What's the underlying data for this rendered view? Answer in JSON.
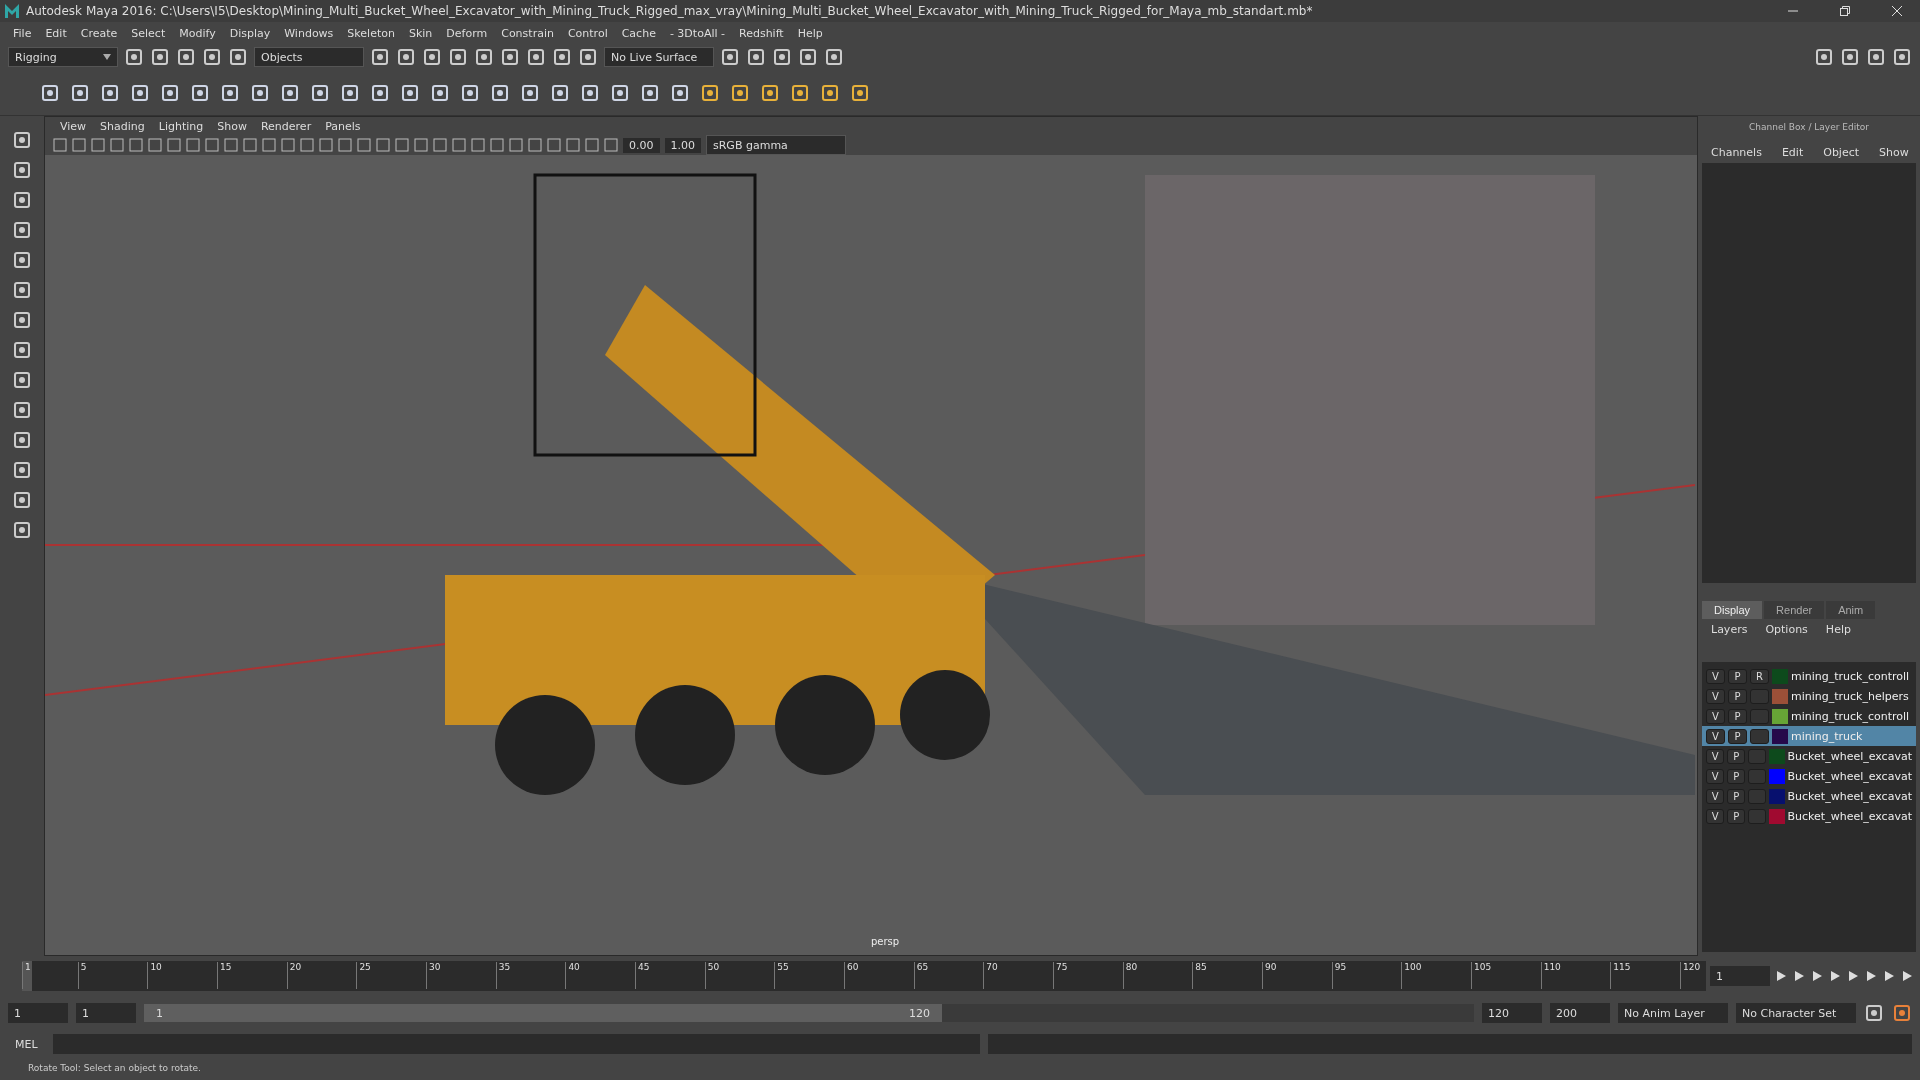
{
  "window": {
    "title": "Autodesk Maya 2016: C:\\Users\\I5\\Desktop\\Mining_Multi_Bucket_Wheel_Excavator_with_Mining_Truck_Rigged_max_vray\\Mining_Multi_Bucket_Wheel_Excavator_with_Mining_Truck_Rigged_for_Maya_mb_standart.mb*"
  },
  "menu": [
    "File",
    "Edit",
    "Create",
    "Select",
    "Modify",
    "Display",
    "Windows",
    "Skeleton",
    "Skin",
    "Deform",
    "Constrain",
    "Control",
    "Cache",
    "- 3DtoAll -",
    "Redshift",
    "Help"
  ],
  "status_line": {
    "mode": "Rigging",
    "selection_mode": "Objects",
    "live_surface": "No Live Surface"
  },
  "viewport": {
    "menu": [
      "View",
      "Shading",
      "Lighting",
      "Show",
      "Renderer",
      "Panels"
    ],
    "exposure": "0.00",
    "gamma": "1.00",
    "color_space": "sRGB gamma",
    "camera": "persp"
  },
  "channel_box": {
    "title": "Channel Box / Layer Editor",
    "menu": [
      "Channels",
      "Edit",
      "Object",
      "Show"
    ]
  },
  "layer_editor": {
    "tabs": [
      {
        "label": "Display",
        "selected": true
      },
      {
        "label": "Render",
        "selected": false
      },
      {
        "label": "Anim",
        "selected": false
      }
    ],
    "menu": [
      "Layers",
      "Options",
      "Help"
    ],
    "layers": [
      {
        "v": "V",
        "p": "P",
        "r": "R",
        "color": "#0d4a1c",
        "name": "mining_truck_controll",
        "selected": false
      },
      {
        "v": "V",
        "p": "P",
        "color": "#9c5038",
        "name": "mining_truck_helpers",
        "selected": false
      },
      {
        "v": "V",
        "p": "P",
        "color": "#67a536",
        "name": "mining_truck_controll",
        "selected": false
      },
      {
        "v": "V",
        "p": "P",
        "color": "#26094a",
        "name": "mining_truck",
        "selected": true
      },
      {
        "v": "V",
        "p": "P",
        "color": "#0d4a1c",
        "name": "Bucket_wheel_excavat",
        "selected": false
      },
      {
        "v": "V",
        "p": "P",
        "color": "#0000ff",
        "name": "Bucket_wheel_excavat",
        "selected": false
      },
      {
        "v": "V",
        "p": "P",
        "color": "#07106e",
        "name": "Bucket_wheel_excavat",
        "selected": false
      },
      {
        "v": "V",
        "p": "P",
        "color": "#a00a30",
        "name": "Bucket_wheel_excavat",
        "selected": false
      }
    ]
  },
  "timeline": {
    "ticks": [
      "1",
      "5",
      "10",
      "15",
      "20",
      "25",
      "30",
      "35",
      "40",
      "45",
      "50",
      "55",
      "60",
      "65",
      "70",
      "75",
      "80",
      "85",
      "90",
      "95",
      "100",
      "105",
      "110",
      "115",
      "120"
    ],
    "current_frame": "1",
    "level": 0
  },
  "range": {
    "start": "1",
    "playback_start": "1",
    "slider_start": "1",
    "slider_end": "120",
    "playback_end": "120",
    "end": "200",
    "anim_layer": "No Anim Layer",
    "character_set": "No Character Set",
    "level": 0.6
  },
  "command_line": {
    "label": "MEL"
  },
  "help_line": "Rotate Tool: Select an object to rotate."
}
